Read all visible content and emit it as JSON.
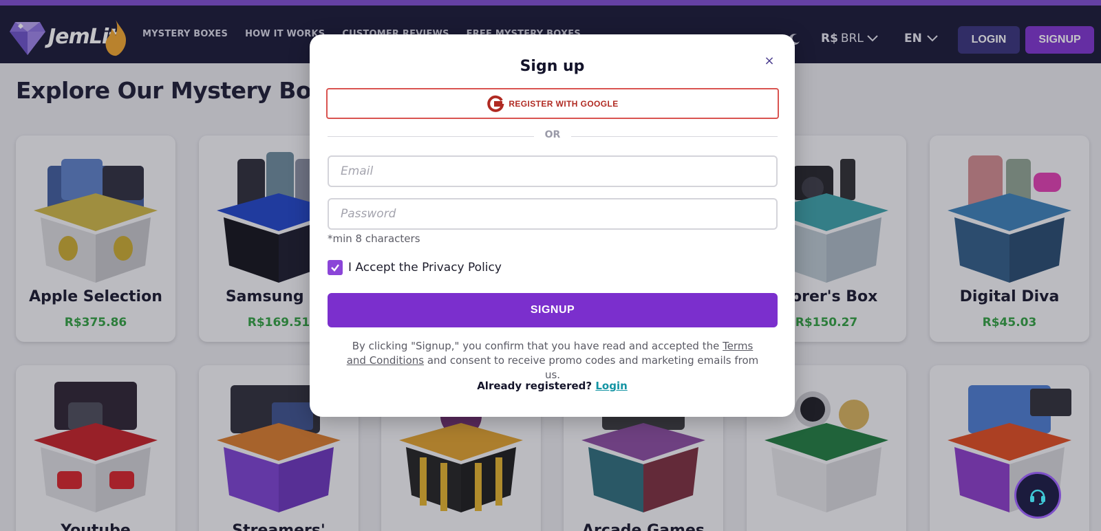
{
  "brand": {
    "name": "JemLit"
  },
  "nav": {
    "links": [
      "MYSTERY BOXES",
      "HOW IT WORKS",
      "CUSTOMER REVIEWS",
      "FREE MYSTERY BOXES"
    ],
    "currency_symbol": "R$",
    "currency_code": "BRL",
    "language": "EN",
    "login_label": "LOGIN",
    "signup_label": "SIGNUP"
  },
  "page": {
    "title": "Explore Our Mystery Boxes"
  },
  "boxes_row1": [
    {
      "name": "Apple Selection",
      "price": "R$375.86"
    },
    {
      "name": "Samsung Ga",
      "price": "R$169.51"
    },
    {
      "name": "plorer's Box",
      "price": "R$150.27"
    },
    {
      "name": "Digital Diva",
      "price": "R$45.03"
    }
  ],
  "boxes_row2": [
    {
      "name": "Youtube"
    },
    {
      "name": "Streamers'"
    },
    {
      "name": ""
    },
    {
      "name": "Arcade Games"
    },
    {
      "name": ""
    },
    {
      "name": ""
    }
  ],
  "modal": {
    "title": "Sign up",
    "close": "×",
    "google_label": "REGISTER WITH GOOGLE",
    "or": "OR",
    "email_placeholder": "Email",
    "password_placeholder": "Password",
    "password_hint": "*min 8 characters",
    "privacy_label": "I Accept the Privacy Policy",
    "privacy_checked": true,
    "signup_label": "SIGNUP",
    "terms_prefix": "By clicking \"Signup,\" you confirm that you have read and accepted the ",
    "terms_link": "Terms and Conditions",
    "terms_suffix": " and consent to receive promo codes and marketing emails from us.",
    "already_text": "Already registered?",
    "login_link": "Login"
  },
  "colors": {
    "navbar": "#161534",
    "accent": "#7b2fcd",
    "price": "#2f9e3f",
    "google_red": "#d9534f",
    "link_teal": "#1595a4"
  },
  "icons": [
    "gem-logo-icon",
    "moon-icon",
    "chevron-down-icon",
    "close-icon",
    "google-icon",
    "checkmark-icon",
    "headset-icon"
  ]
}
